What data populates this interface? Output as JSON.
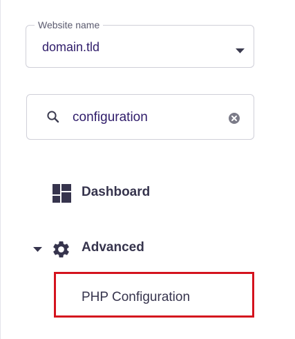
{
  "website": {
    "label": "Website name",
    "value": "domain.tld",
    "caret_icon": "caret-down-icon"
  },
  "search": {
    "value": "configuration",
    "search_icon": "search-icon",
    "clear_icon": "clear-icon"
  },
  "nav": {
    "dashboard": {
      "label": "Dashboard",
      "icon": "dashboard-icon"
    },
    "advanced": {
      "label": "Advanced",
      "icon": "gear-icon",
      "expanded": true,
      "items": [
        {
          "label": "PHP Configuration",
          "highlighted": true
        }
      ]
    }
  },
  "colors": {
    "text_primary": "#2f1c6a",
    "nav_text": "#36344d",
    "highlight_border": "#d4121d",
    "field_border": "#cfcfd8"
  }
}
